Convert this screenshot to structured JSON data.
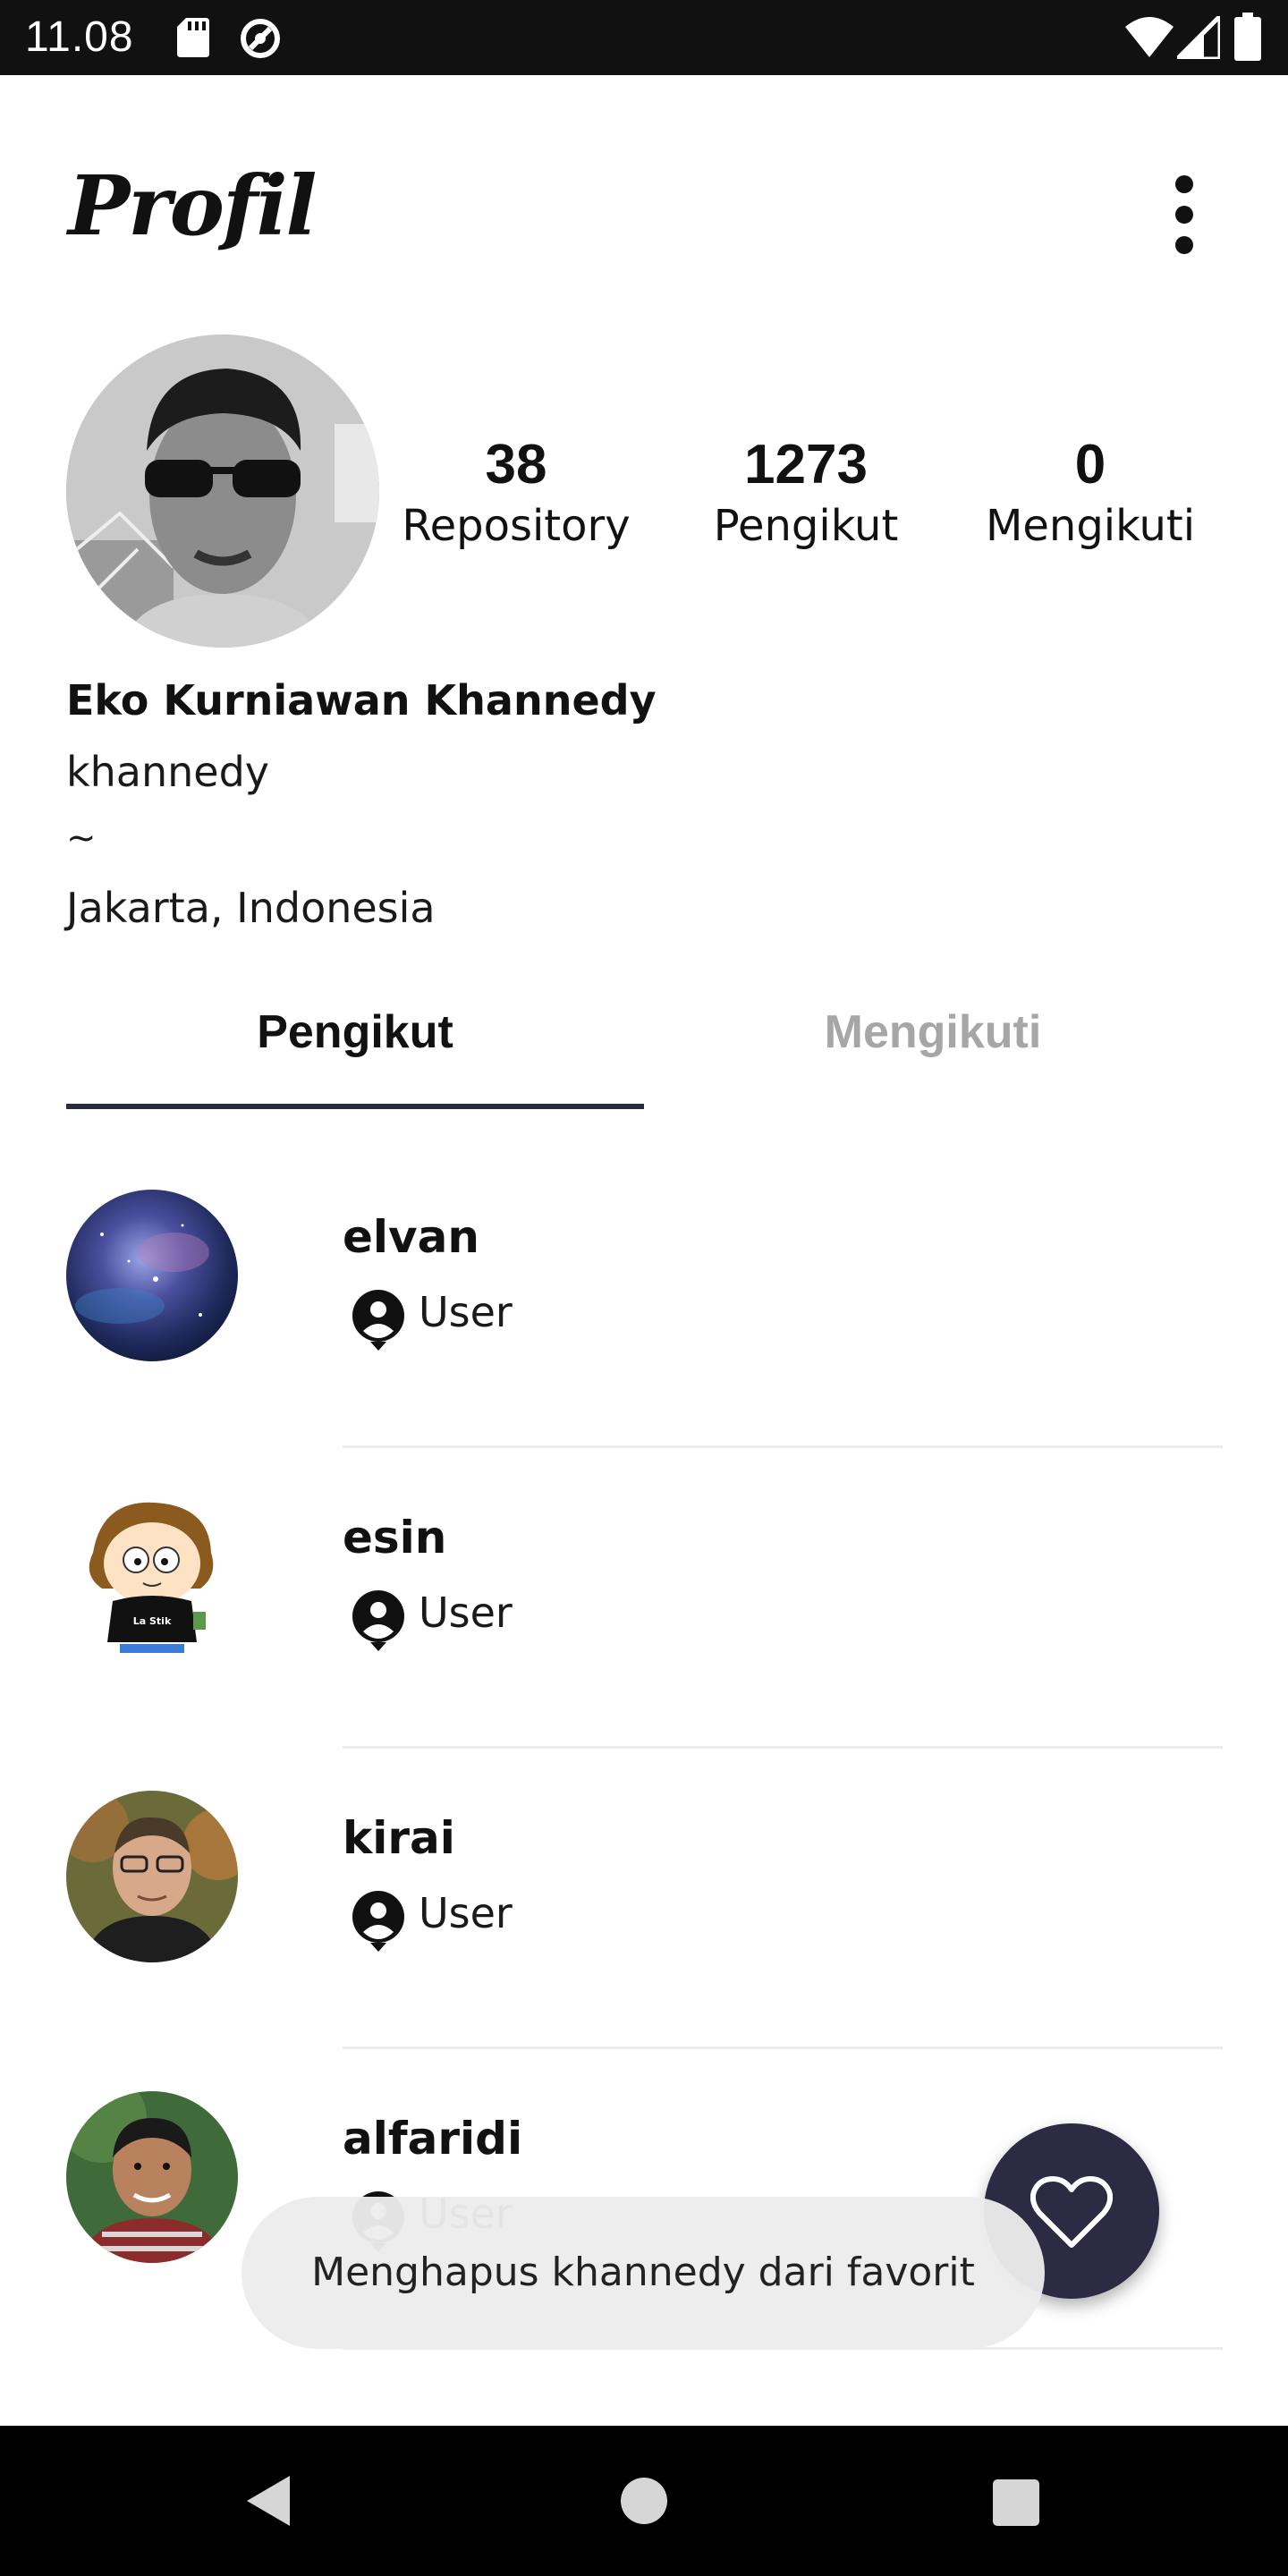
{
  "status_bar": {
    "time": "11.08",
    "icons": [
      "sd-card-icon",
      "sync-icon",
      "wifi-icon",
      "cellular-signal-icon",
      "battery-icon"
    ]
  },
  "app_bar": {
    "title": "Profil",
    "menu_icon": "more-vertical-icon"
  },
  "profile": {
    "name": "Eko Kurniawan Khannedy",
    "username": "khannedy",
    "bio": "~",
    "location": "Jakarta, Indonesia",
    "stats": {
      "repository": {
        "value": "38",
        "label": "Repository"
      },
      "followers": {
        "value": "1273",
        "label": "Pengikut"
      },
      "following": {
        "value": "0",
        "label": "Mengikuti"
      }
    }
  },
  "tabs": [
    {
      "label": "Pengikut",
      "selected": true
    },
    {
      "label": "Mengikuti",
      "selected": false
    }
  ],
  "list": [
    {
      "login": "elvan",
      "type": "User",
      "avatar": "galaxy-avatar"
    },
    {
      "login": "esin",
      "type": "User",
      "avatar": "cartoon-avatar"
    },
    {
      "login": "kirai",
      "type": "User",
      "avatar": "photo-avatar"
    },
    {
      "login": "alfaridi",
      "type": "User",
      "avatar": "photo-avatar"
    }
  ],
  "fab": {
    "icon": "heart-outline-icon"
  },
  "toast": {
    "message": "Menghapus khannedy dari favorit"
  },
  "colors": {
    "accent": "#2d2b44",
    "tab_indicator": "#2b2b3e",
    "tab_inactive": "#a6a6a6",
    "status_bar": "#111111",
    "nav_bar": "#000000"
  }
}
